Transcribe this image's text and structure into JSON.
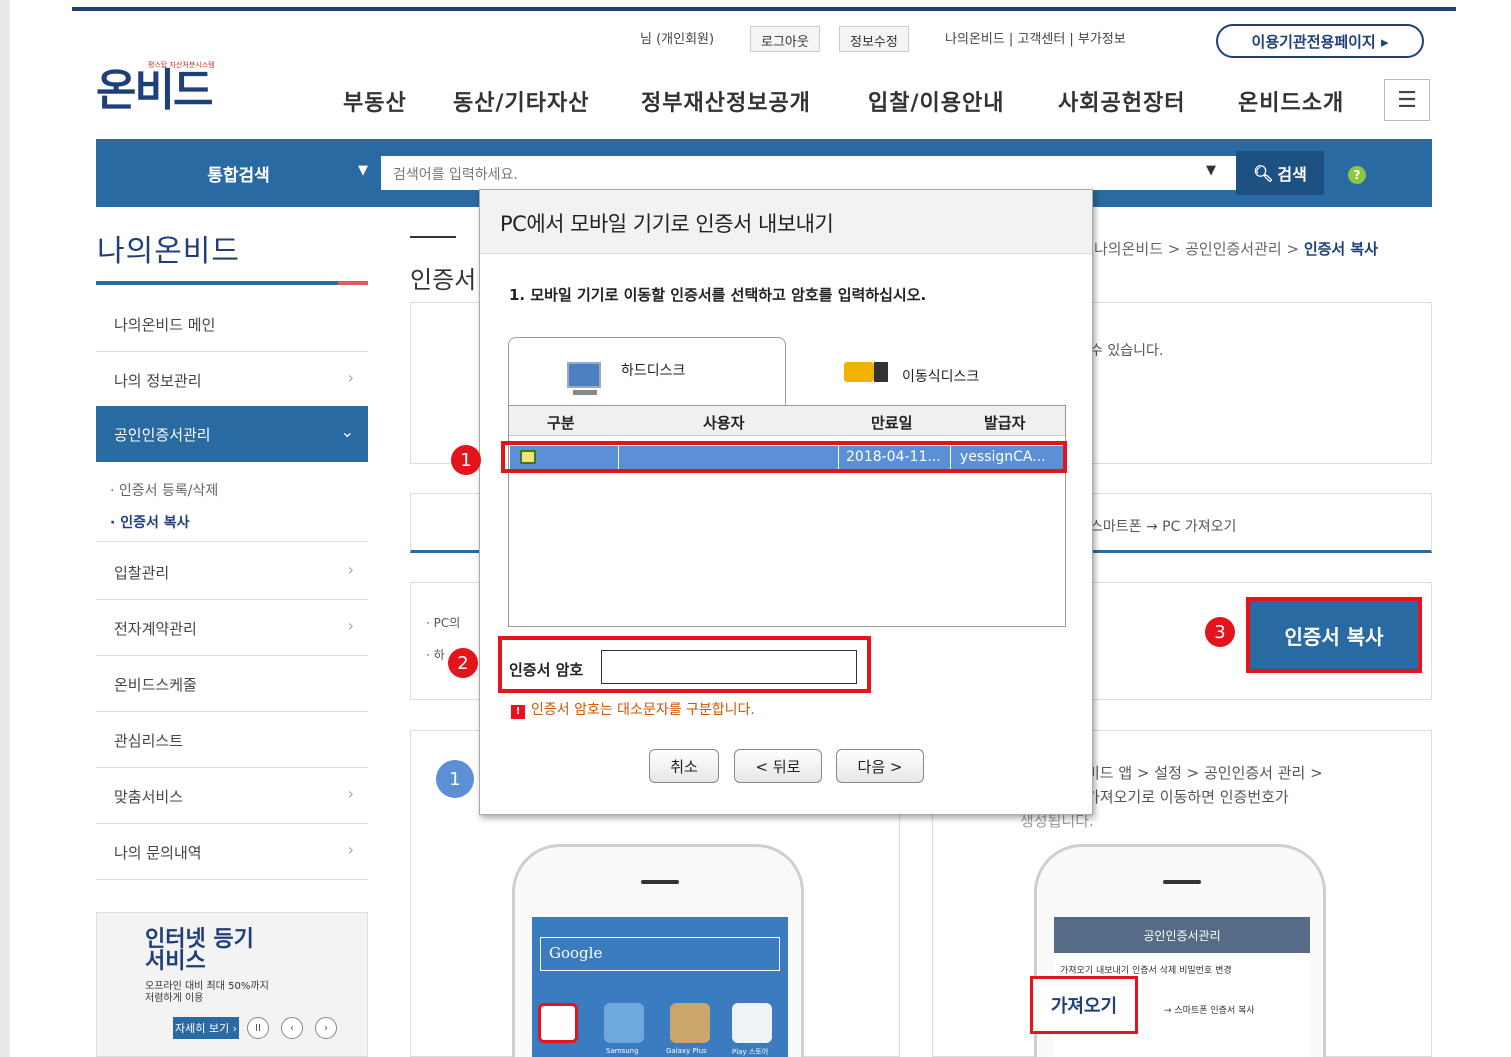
{
  "header": {
    "logo": "온비드",
    "logo_sub": "평스탑 자산처분시스템",
    "user_info": "님 (개인회원)",
    "logout": "로그아웃",
    "edit_info": "정보수정",
    "util_links": "나의온비드 | 고객센터 | 부가정보",
    "org_page": "이용기관전용페이지 ▸",
    "nav": [
      "부동산",
      "동산/기타자산",
      "정부재산정보공개",
      "입찰/이용안내",
      "사회공헌장터",
      "온비드소개"
    ]
  },
  "search": {
    "category": "통합검색",
    "placeholder": "검색어를 입력하세요.",
    "button": "검색",
    "help": "?"
  },
  "sidebar": {
    "title": "나의온비드",
    "items": [
      {
        "label": "나의온비드 메인"
      },
      {
        "label": "나의 정보관리"
      },
      {
        "label": "공인인증서관리"
      },
      {
        "label": "입찰관리"
      },
      {
        "label": "전자계약관리"
      },
      {
        "label": "온비드스케줄"
      },
      {
        "label": "관심리스트"
      },
      {
        "label": "맞춤서비스"
      },
      {
        "label": "나의 문의내역"
      }
    ],
    "sub_items": [
      "· 인증서 등록/삭제",
      "· 인증서 복사"
    ],
    "banner": {
      "title1": "인터넷 등기",
      "title2": "서비스",
      "desc1": "오프라인 대비 최대 50%까지",
      "desc2": "저렴하게 이용",
      "button": "자세히 보기 ›"
    }
  },
  "content": {
    "title": "인증서",
    "breadcrumb_path": "나의온비드 > 공인인증서관리 > ",
    "breadcrumb_current": "인증서 복사",
    "partial_text1": "수 있습니다.",
    "tab_right": "스마트폰 → PC 가져오기",
    "note1": "· PC의",
    "note2": "· 하",
    "copy_button": "인증서 복사",
    "step_num": "1",
    "right_guide1": "비드 앱 > 설정 > 공인인증서 관리 >",
    "right_guide2": "가져오기로 이동하면 인증번호가",
    "right_guide3": "생성됩니다.",
    "phone1": {
      "search": "Google",
      "apps": [
        "Samsung",
        "Galaxy Plus",
        "Play 스토어"
      ]
    },
    "phone2": {
      "header": "공인인증서관리",
      "tabs": "가져오기  내보내기  인증서 삭제  비밀번호 변경",
      "pull_button": "가져오기",
      "pull_caption": "→ 스마트폰 인증서 복사"
    }
  },
  "dialog": {
    "title": "PC에서 모바일 기기로 인증서 내보내기",
    "instruction": "1. 모바일 기기로 이동할 인증서를 선택하고 암호를 입력하십시오.",
    "tabs": {
      "hdd": "하드디스크",
      "removable": "이동식디스크"
    },
    "columns": [
      "구분",
      "사용자",
      "만료일",
      "발급자"
    ],
    "rows": [
      {
        "type": "",
        "user": "",
        "expiry": "2018-04-11...",
        "issuer": "yessignCA..."
      }
    ],
    "password_label": "인증서 암호",
    "password_value": "",
    "warning": "인증서 암호는 대소문자를 구분합니다.",
    "buttons": {
      "cancel": "취소",
      "back": "< 뒤로",
      "next": "다음 >"
    }
  },
  "markers": [
    "1",
    "2",
    "3"
  ],
  "colors": {
    "brand": "#1f3f7a",
    "accent": "#2a6aa3",
    "highlight": "#e4141b",
    "selected_row": "#5b8fd6"
  }
}
